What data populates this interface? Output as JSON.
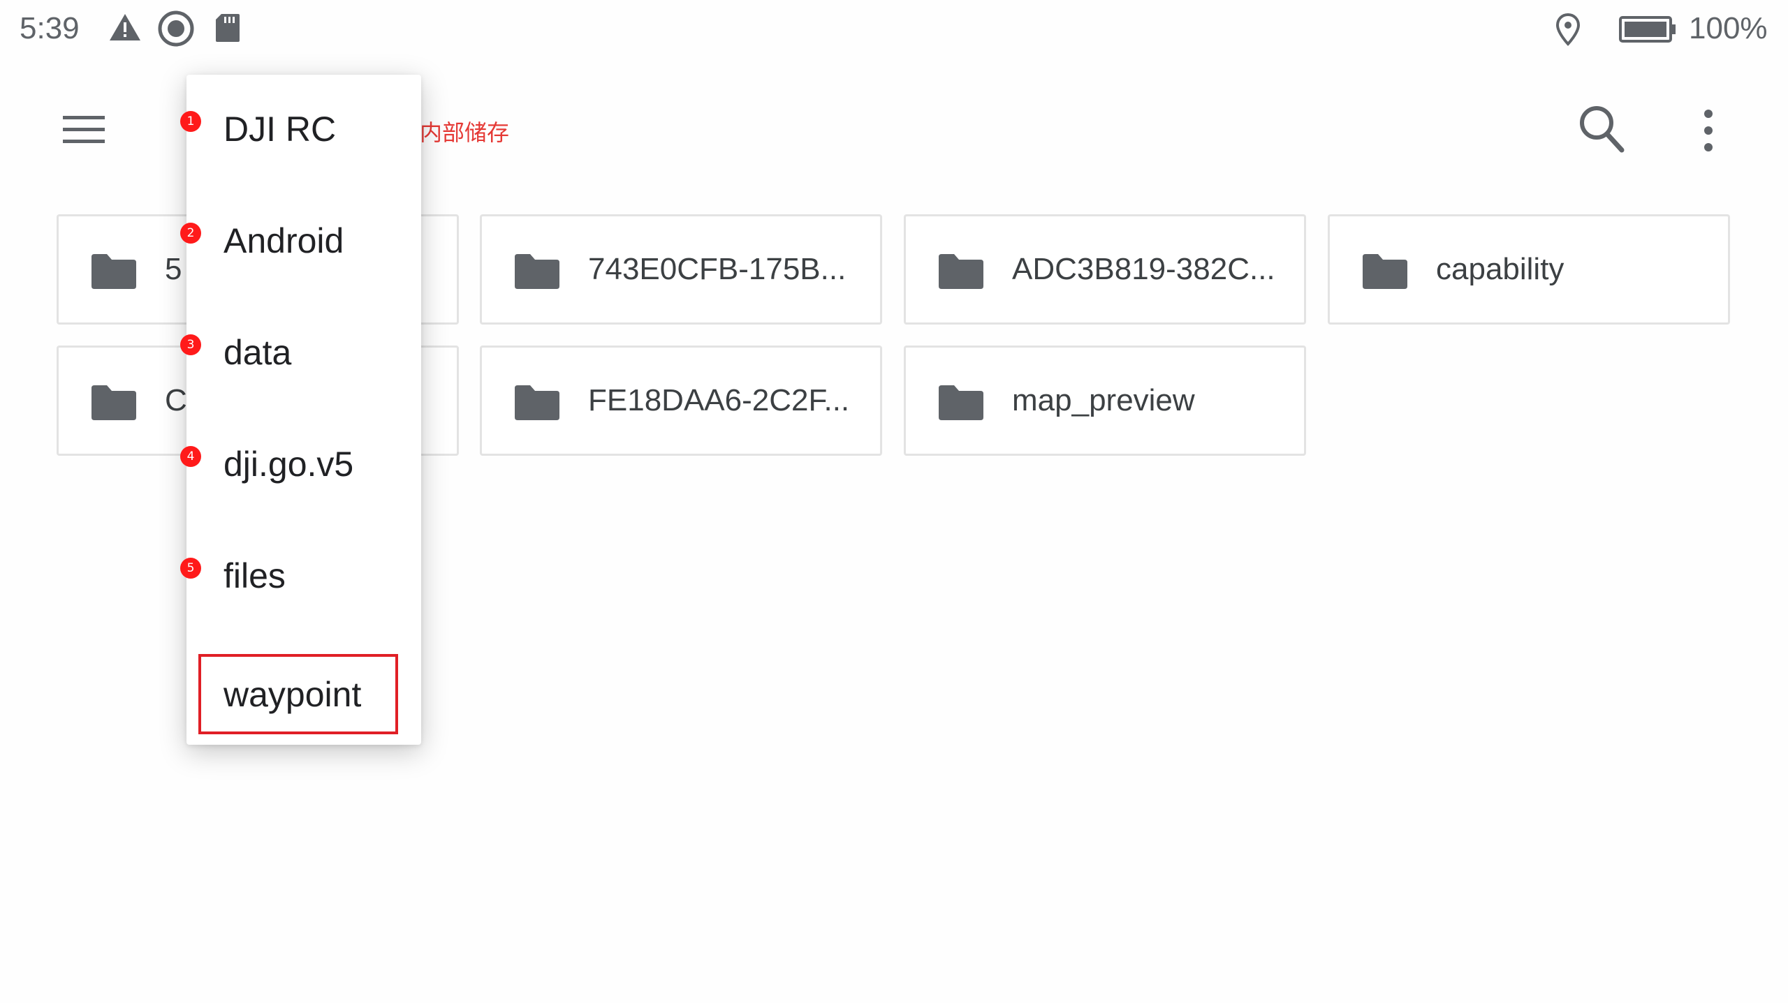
{
  "status_bar": {
    "time": "5:39",
    "battery": "100%",
    "icons": [
      "warning-icon",
      "record-icon",
      "sd-card-icon",
      "location-icon",
      "battery-icon"
    ]
  },
  "app_bar": {
    "icons": [
      "menu-icon",
      "search-icon",
      "more-vert-icon"
    ]
  },
  "annotation": "屏控内部储存",
  "folders": [
    {
      "name": "5"
    },
    {
      "name": "743E0CFB-175B..."
    },
    {
      "name": "ADC3B819-382C..."
    },
    {
      "name": "capability"
    },
    {
      "name": "C"
    },
    {
      "name": "FE18DAA6-2C2F..."
    },
    {
      "name": "map_preview"
    }
  ],
  "breadcrumb_menu": {
    "items": [
      {
        "marker": "1",
        "label": "DJI RC"
      },
      {
        "marker": "2",
        "label": "Android"
      },
      {
        "marker": "3",
        "label": "data"
      },
      {
        "marker": "4",
        "label": "dji.go.v5"
      },
      {
        "marker": "5",
        "label": "files"
      },
      {
        "marker": "",
        "label": "waypoint"
      }
    ],
    "highlighted": "waypoint"
  },
  "colors": {
    "marker": "#ff1a1a",
    "highlight_box": "#e01f26",
    "icon_gray": "#5f6368",
    "folder_gray": "#5f6368",
    "card_border": "#e3e3e3"
  }
}
